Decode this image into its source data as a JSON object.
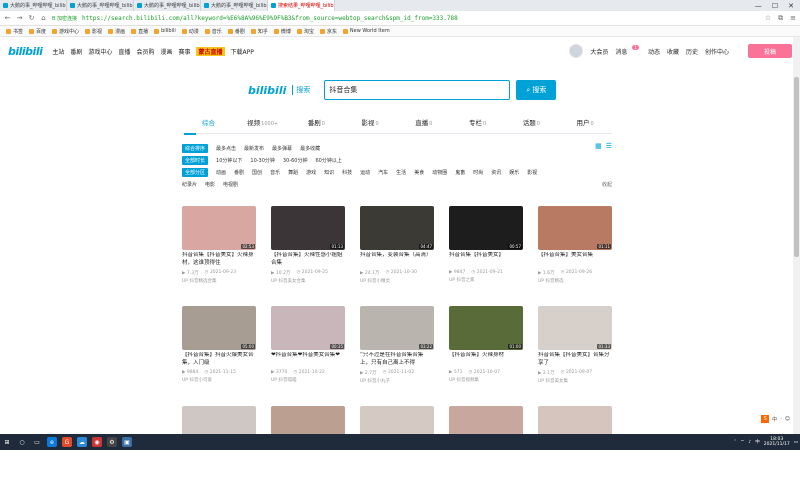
{
  "browser": {
    "tabs": [
      {
        "label": "大鹅的事_哔哩哔哩_bilibili",
        "active": false
      },
      {
        "label": "大鹅的事_哔哩哔哩_bilibili",
        "active": false
      },
      {
        "label": "大鹅的事_哔哩哔哩_bilibili",
        "active": false
      },
      {
        "label": "大鹅的事_哔哩哔哩_bilibili",
        "active": false
      },
      {
        "label": "搜索结果_哔哩哔哩_bilibili",
        "active": true
      }
    ],
    "win_controls": [
      "—",
      "☐",
      "✕"
    ],
    "secure_label": "B 加密连接",
    "url": "https://search.bilibili.com/all?keyword=%E6%8A%96%E9%9F%B3&from_source=webtop_search&spm_id_from=333.788",
    "bookmarks": [
      "书签",
      "百度",
      "游戏中心",
      "影视",
      "漫画",
      "直播",
      "bilibili",
      "动漫",
      "音乐",
      "番剧",
      "知乎",
      "微博",
      "淘宝",
      "京东",
      "New World Item"
    ]
  },
  "bili_nav": {
    "logo": "bilibili",
    "items": [
      "主站",
      "番剧",
      "游戏中心",
      "直播",
      "会员购",
      "漫画",
      "赛事",
      "蒙古直播",
      "下载APP"
    ],
    "right_items": [
      "大会员",
      "消息",
      "动态",
      "收藏",
      "历史",
      "创作中心"
    ],
    "msg_badge": "1",
    "upload_label": "投稿"
  },
  "search": {
    "logo": "bilibili",
    "logo_sub": "搜索",
    "query": "抖音合集",
    "button_label": "搜索"
  },
  "result_tabs": [
    {
      "label": "综合",
      "count": "",
      "active": true
    },
    {
      "label": "视频",
      "count": "1000+",
      "active": false
    },
    {
      "label": "番剧",
      "count": "0",
      "active": false
    },
    {
      "label": "影视",
      "count": "0",
      "active": false
    },
    {
      "label": "直播",
      "count": "0",
      "active": false
    },
    {
      "label": "专栏",
      "count": "0",
      "active": false
    },
    {
      "label": "话题",
      "count": "0",
      "active": false
    },
    {
      "label": "用户",
      "count": "0",
      "active": false
    }
  ],
  "filters": {
    "sort": [
      "综合排序",
      "最多点击",
      "最新发布",
      "最多弹幕",
      "最多收藏"
    ],
    "duration": [
      "全部时长",
      "10分钟以下",
      "10-30分钟",
      "30-60分钟",
      "60分钟以上"
    ],
    "zones": [
      "全部分区",
      "动画",
      "番剧",
      "国创",
      "音乐",
      "舞蹈",
      "游戏",
      "知识",
      "科技",
      "运动",
      "汽车",
      "生活",
      "美食",
      "动物圈",
      "鬼畜",
      "时尚",
      "资讯",
      "娱乐",
      "影视",
      "纪录片",
      "电影",
      "电视剧"
    ],
    "collapse": "收起"
  },
  "videos": [
    {
      "title": "抖音合集【抖音美女】火辣身材，这谁顶得住",
      "duration": "02:53",
      "views": "7.3万",
      "date": "2021-09-23",
      "up": "抖音精选合集"
    },
    {
      "title": "【抖音合集】火辣性感小姐姐合集",
      "duration": "01:13",
      "views": "10.2万",
      "date": "2021-09-25",
      "up": "抖音美女合集"
    },
    {
      "title": "抖音合集，变装合集（高清）",
      "duration": "04:47",
      "views": "24.1万",
      "date": "2021-10-30",
      "up": "抖音小精灵"
    },
    {
      "title": "抖音合集【抖音美女】",
      "duration": "00:57",
      "views": "9847",
      "date": "2021-09-21",
      "up": "抖音之家"
    },
    {
      "title": "【抖音合集】美女合集",
      "duration": "01:11",
      "views": "1.6万",
      "date": "2021-09-26",
      "up": "抖音精选"
    },
    {
      "title": "【抖音合集】抖音火爆美女合集，入门级",
      "duration": "05:00",
      "views": "9884",
      "date": "2021-11-15",
      "up": "抖音小可爱"
    },
    {
      "title": "❤抖音合集❤抖音美女合集❤",
      "duration": "00:35",
      "views": "3770",
      "date": "2021-10-22",
      "up": "抖音喵喵"
    },
    {
      "title": "“只不过是在抖音合集合集上，只有自己离上不得",
      "duration": "03:22",
      "views": "2.7万",
      "date": "2021-11-02",
      "up": "抖音小丸子"
    },
    {
      "title": "【抖音合集】火辣身材",
      "duration": "01:00",
      "views": "571",
      "date": "2021-10-07",
      "up": "抖音视频集"
    },
    {
      "title": "抖音合集【抖音美女】合集分享了",
      "duration": "01:33",
      "views": "2.1万",
      "date": "2021-09-07",
      "up": "抖音美女集"
    },
    {
      "title": "",
      "duration": "",
      "views": "",
      "date": "",
      "up": ""
    },
    {
      "title": "",
      "duration": "",
      "views": "",
      "date": "",
      "up": ""
    },
    {
      "title": "",
      "duration": "",
      "views": "",
      "date": "",
      "up": ""
    },
    {
      "title": "",
      "duration": "",
      "views": "",
      "date": "",
      "up": ""
    },
    {
      "title": "",
      "duration": "",
      "views": "",
      "date": "",
      "up": ""
    }
  ],
  "thumb_colors": [
    "#d9a7a1",
    "#3b3538",
    "#3c3a35",
    "#1d1d1d",
    "#b87a63",
    "#a89d92",
    "#c9b6ba",
    "#b9b5ae",
    "#5a6b3a",
    "#d7cfc9",
    "#cfc7c4",
    "#bb9f91",
    "#d5c9c4",
    "#c8a79f",
    "#d6c4be"
  ],
  "side_float": {
    "s_label": "S",
    "items": [
      "中",
      "·",
      "☺"
    ]
  },
  "taskbar": {
    "icons": [
      "⊞",
      "○",
      "▭",
      "e",
      "G",
      "☁",
      "◉",
      "⚙",
      "▣"
    ],
    "time": "18:03",
    "date": "2021/11/17",
    "lang": "中"
  },
  "colors": {
    "accent": "#00a1d6",
    "pink": "#fb7299",
    "keyword": "#f25d8e"
  }
}
